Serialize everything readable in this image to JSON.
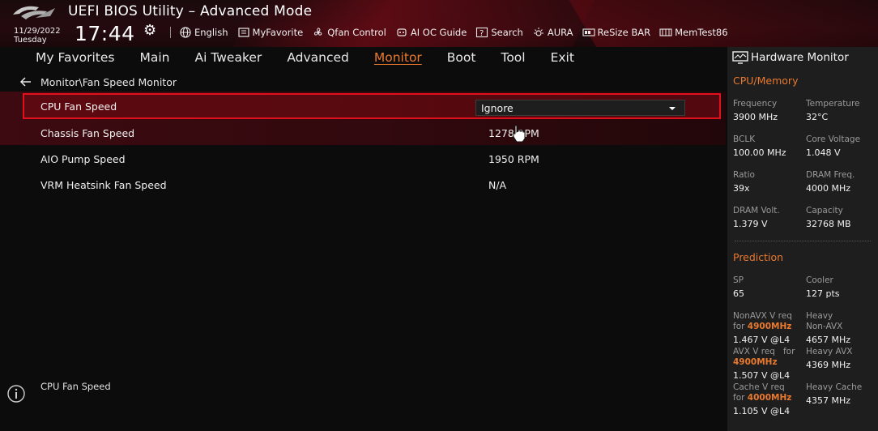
{
  "app": {
    "title": "UEFI BIOS Utility – Advanced Mode"
  },
  "datetime": {
    "date": "11/29/2022",
    "day": "Tuesday",
    "time": "17:44"
  },
  "toolbar": [
    {
      "label": "English",
      "icon": "globe-icon"
    },
    {
      "label": "MyFavorite",
      "icon": "favorite-icon"
    },
    {
      "label": "Qfan Control",
      "icon": "fan-icon"
    },
    {
      "label": "AI OC Guide",
      "icon": "ai-oc-icon"
    },
    {
      "label": "Search",
      "icon": "search-icon"
    },
    {
      "label": "AURA",
      "icon": "aura-icon"
    },
    {
      "label": "ReSize BAR",
      "icon": "resize-bar-icon"
    },
    {
      "label": "MemTest86",
      "icon": "memtest-icon"
    }
  ],
  "nav": {
    "items": [
      "My Favorites",
      "Main",
      "Ai Tweaker",
      "Advanced",
      "Monitor",
      "Boot",
      "Tool",
      "Exit"
    ],
    "active": "Monitor"
  },
  "breadcrumb": "Monitor\\Fan Speed Monitor",
  "rows": [
    {
      "label": "CPU Fan Speed",
      "value": "Ignore",
      "type": "select"
    },
    {
      "label": "Chassis Fan Speed",
      "value": "1278 RPM",
      "type": "text"
    },
    {
      "label": "AIO Pump Speed",
      "value": "1950 RPM",
      "type": "text"
    },
    {
      "label": "VRM Heatsink Fan Speed",
      "value": "N/A",
      "type": "text"
    }
  ],
  "help_text": "CPU Fan Speed",
  "hardware_monitor": {
    "title": "Hardware Monitor",
    "cpu_memory": {
      "title": "CPU/Memory",
      "items": [
        {
          "label": "Frequency",
          "value": "3900 MHz"
        },
        {
          "label": "Temperature",
          "value": "32°C"
        },
        {
          "label": "BCLK",
          "value": "100.00 MHz"
        },
        {
          "label": "Core Voltage",
          "value": "1.048 V"
        },
        {
          "label": "Ratio",
          "value": "39x"
        },
        {
          "label": "DRAM Freq.",
          "value": "4000 MHz"
        },
        {
          "label": "DRAM Volt.",
          "value": "1.379 V"
        },
        {
          "label": "Capacity",
          "value": "32768 MB"
        }
      ]
    },
    "prediction": {
      "title": "Prediction",
      "sp": {
        "label": "SP",
        "value": "65"
      },
      "cooler": {
        "label": "Cooler",
        "value": "127 pts"
      },
      "nonavx": {
        "label": "NonAVX V req",
        "for": "for",
        "freq": "4900MHz",
        "value": "1.467 V @L4"
      },
      "heavy_nonavx": {
        "label1": "Heavy",
        "label2": "Non-AVX",
        "value": "4657 MHz"
      },
      "avx": {
        "label": "AVX V req",
        "for": "for",
        "freq": "4900MHz",
        "value": "1.507 V @L4"
      },
      "heavy_avx": {
        "label": "Heavy AVX",
        "value": "4369 MHz"
      },
      "cache": {
        "label": "Cache V req",
        "for": "for",
        "freq": "4000MHz",
        "value": "1.105 V @L4"
      },
      "heavy_cache": {
        "label": "Heavy Cache",
        "value": "4357 MHz"
      }
    }
  },
  "colors": {
    "accent": "#e9792e",
    "highlight_border": "#e0101c",
    "panel": "#1e1e1e"
  }
}
